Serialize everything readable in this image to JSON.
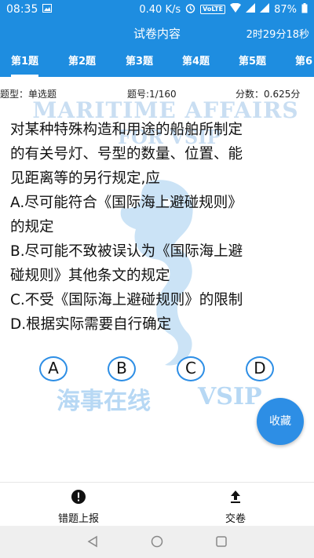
{
  "status_bar": {
    "time": "08:35",
    "speed": "0.40 K/s",
    "lte": "VoLTE",
    "battery": "87%"
  },
  "header": {
    "title": "试卷内容",
    "timer": "2时29分18秒"
  },
  "tabs": [
    {
      "label": "第1题"
    },
    {
      "label": "第2题"
    },
    {
      "label": "第3题"
    },
    {
      "label": "第4题"
    },
    {
      "label": "第5题"
    },
    {
      "label": "第6"
    }
  ],
  "info": {
    "type": "题型：单选题",
    "number": "题号:1/160",
    "score": "分数：0.625分"
  },
  "watermark": {
    "line1": "MARITIME AFFAIRS",
    "line2": "FOR VSIP",
    "bottom": "海事在线",
    "bottom_latin": "VSIP"
  },
  "question": {
    "lines": [
      "对某种特殊构造和用途的船舶所制定",
      "的有关号灯、号型的数量、位置、能",
      "见距离等的另行规定,应",
      "A.尽可能符合《国际海上避碰规则》",
      "的规定",
      "B.尽可能不致被误认为《国际海上避",
      "碰规则》其他条文的规定",
      "C.不受《国际海上避碰规则》的限制",
      "D.根据实际需要自行确定"
    ]
  },
  "answers": [
    "A",
    "B",
    "C",
    "D"
  ],
  "collect_label": "收藏",
  "bottom_bar": {
    "report_label": "错题上报",
    "submit_label": "交卷"
  },
  "colors": {
    "primary": "#1e8de0",
    "accent": "#2d8ee5",
    "watermark": "#c9def2"
  }
}
